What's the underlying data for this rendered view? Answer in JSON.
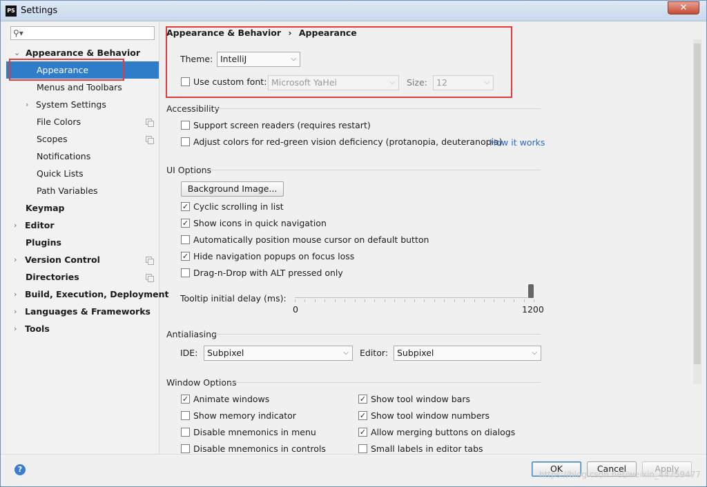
{
  "window": {
    "title": "Settings",
    "app_logo": "PS"
  },
  "search": {
    "placeholder": "",
    "value": ""
  },
  "sidebar": {
    "items": [
      {
        "label": "Appearance & Behavior",
        "arrow": "⌄",
        "bold": true
      },
      {
        "label": "Appearance",
        "selected": true
      },
      {
        "label": "Menus and Toolbars"
      },
      {
        "label": "System Settings",
        "arrow": "›"
      },
      {
        "label": "File Colors"
      },
      {
        "label": "Scopes"
      },
      {
        "label": "Notifications"
      },
      {
        "label": "Quick Lists"
      },
      {
        "label": "Path Variables"
      },
      {
        "label": "Keymap",
        "bold": true
      },
      {
        "label": "Editor",
        "arrow": "›",
        "bold": true
      },
      {
        "label": "Plugins",
        "bold": true
      },
      {
        "label": "Version Control",
        "arrow": "›",
        "bold": true
      },
      {
        "label": "Directories",
        "bold": true
      },
      {
        "label": "Build, Execution, Deployment",
        "arrow": "›",
        "bold": true
      },
      {
        "label": "Languages & Frameworks",
        "arrow": "›",
        "bold": true
      },
      {
        "label": "Tools",
        "arrow": "›",
        "bold": true
      }
    ]
  },
  "breadcrumb": {
    "parent": "Appearance & Behavior",
    "separator": "›",
    "current": "Appearance"
  },
  "theme": {
    "label": "Theme:",
    "value": "IntelliJ"
  },
  "custom_font": {
    "label": "Use custom font:",
    "checked": false,
    "font_value": "Microsoft YaHei",
    "size_label": "Size:",
    "size_value": "12"
  },
  "accessibility": {
    "title": "Accessibility",
    "screen_readers": {
      "label": "Support screen readers (requires restart)",
      "checked": false
    },
    "color_adjust": {
      "label": "Adjust colors for red-green vision deficiency (protanopia, deuteranopia)",
      "checked": false
    },
    "how_it_works": "How it works"
  },
  "ui_options": {
    "title": "UI Options",
    "background_image_button": "Background Image...",
    "options": [
      {
        "label": "Cyclic scrolling in list",
        "checked": true
      },
      {
        "label": "Show icons in quick navigation",
        "checked": true
      },
      {
        "label": "Automatically position mouse cursor on default button",
        "checked": false
      },
      {
        "label": "Hide navigation popups on focus loss",
        "checked": true
      },
      {
        "label": "Drag-n-Drop with ALT pressed only",
        "checked": false
      }
    ],
    "tooltip_delay": {
      "label": "Tooltip initial delay (ms):",
      "min_label": "0",
      "max_label": "1200",
      "value": 1200,
      "max": 1200
    }
  },
  "antialiasing": {
    "title": "Antialiasing",
    "ide_label": "IDE:",
    "ide_value": "Subpixel",
    "editor_label": "Editor:",
    "editor_value": "Subpixel"
  },
  "window_options": {
    "title": "Window Options",
    "left": [
      {
        "label": "Animate windows",
        "checked": true
      },
      {
        "label": "Show memory indicator",
        "checked": false
      },
      {
        "label": "Disable mnemonics in menu",
        "checked": false
      },
      {
        "label": "Disable mnemonics in controls",
        "checked": false
      }
    ],
    "right": [
      {
        "label": "Show tool window bars",
        "checked": true
      },
      {
        "label": "Show tool window numbers",
        "checked": true
      },
      {
        "label": "Allow merging buttons on dialogs",
        "checked": true
      },
      {
        "label": "Small labels in editor tabs",
        "checked": false
      }
    ]
  },
  "footer": {
    "help": "?",
    "ok": "OK",
    "cancel": "Cancel",
    "apply": "Apply",
    "watermark": "https://blog.csdn.net/weixin_44759477"
  },
  "colors": {
    "selection": "#2f7cc9",
    "highlight_box": "#e03a3a",
    "link": "#2c67c9"
  }
}
